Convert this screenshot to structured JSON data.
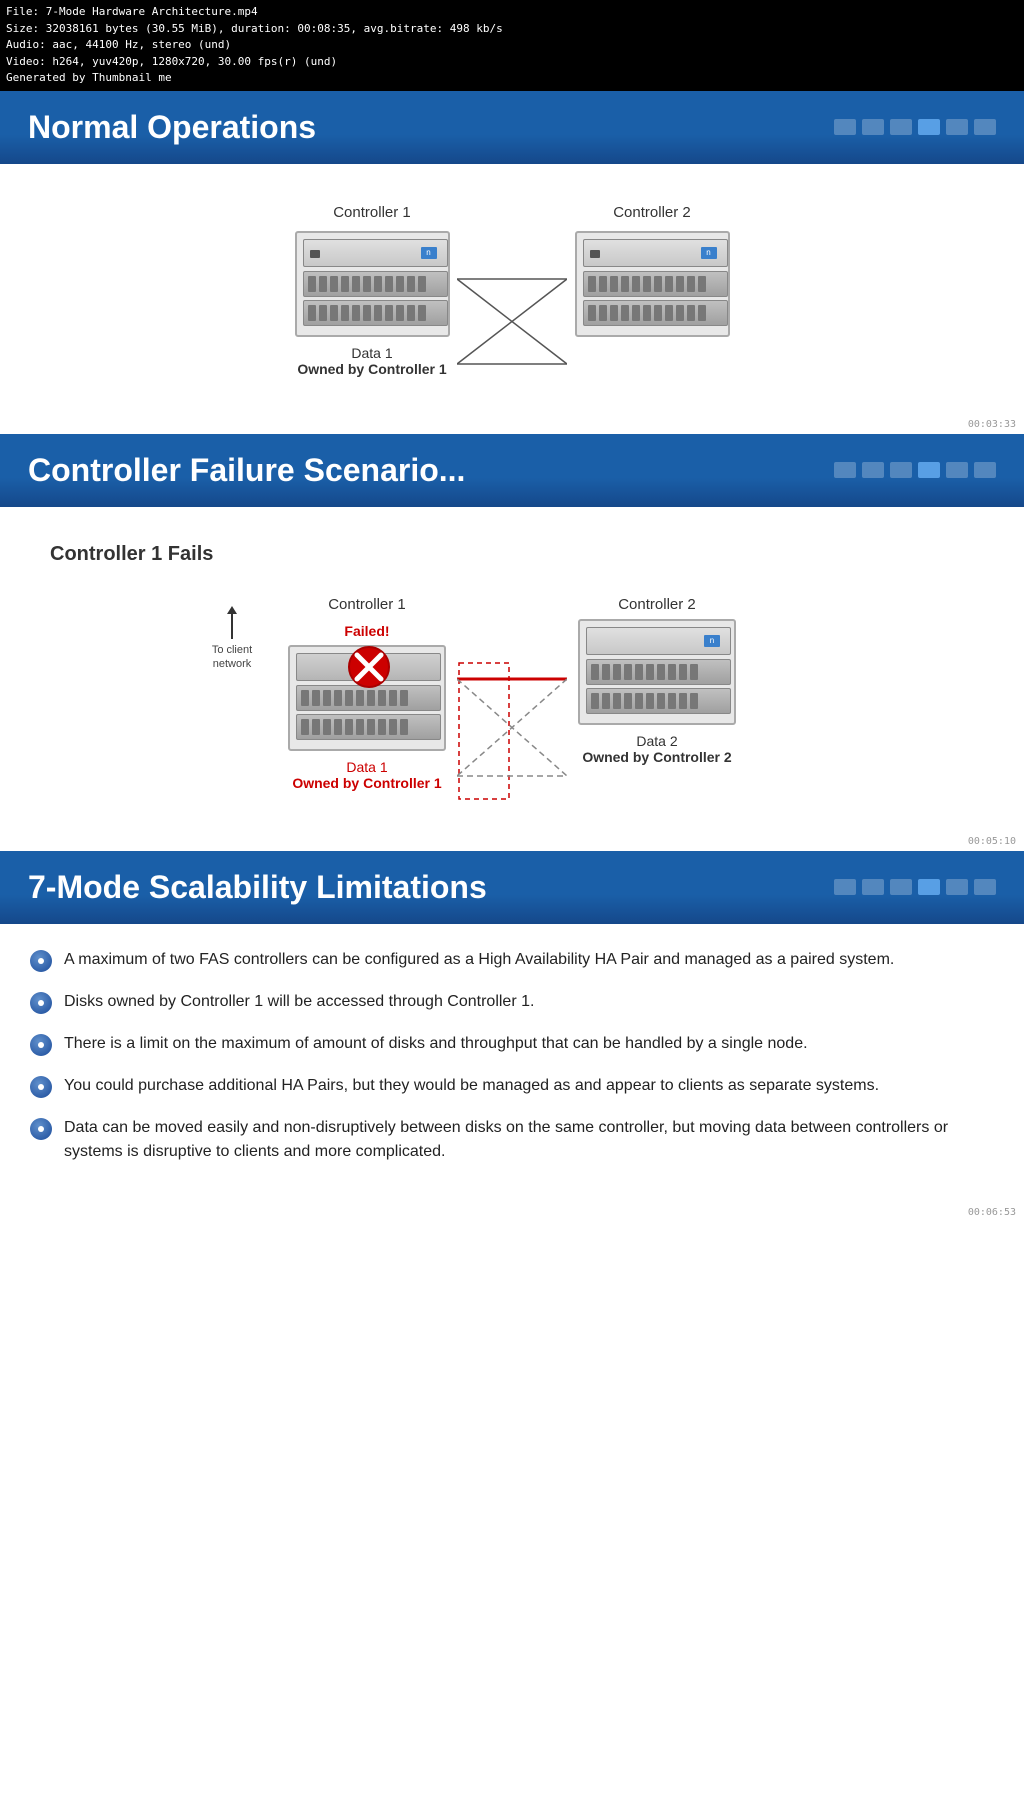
{
  "fileInfo": {
    "line1": "File: 7-Mode Hardware Architecture.mp4",
    "line2": "Size: 32038161 bytes (30.55 MiB), duration: 00:08:35, avg.bitrate: 498 kb/s",
    "line3": "Audio: aac, 44100 Hz, stereo (und)",
    "line4": "Video: h264, yuv420p, 1280x720, 30.00 fps(r) (und)",
    "line5": "Generated by Thumbnail me"
  },
  "slides": {
    "slide1": {
      "title": "Normal Operations",
      "controller1Label": "Controller 1",
      "controller2Label": "Controller 2",
      "data1Label": "Data 1",
      "data1Owner": "Owned by Controller 1",
      "timestamp": "00:03:33",
      "navDots": [
        false,
        false,
        false,
        true,
        false,
        false
      ]
    },
    "slide2": {
      "title": "Controller Failure Scenario...",
      "subtitle": "Controller 1 Fails",
      "controller1Label": "Controller 1",
      "controller1Status": "Failed!",
      "controller2Label": "Controller 2",
      "data1Label": "Data 1",
      "data1Owner": "Owned by Controller 1",
      "data2Label": "Data 2",
      "data2Owner": "Owned by Controller 2",
      "toClientLabel": "To client network",
      "timestamp": "00:05:10",
      "navDots": [
        false,
        false,
        false,
        true,
        false,
        false
      ]
    },
    "slide3": {
      "title": "7-Mode Scalability Limitations",
      "timestamp": "00:06:53",
      "navDots": [
        false,
        false,
        false,
        true,
        false,
        false
      ],
      "bullets": [
        "A maximum of two FAS controllers can be configured as a High Availability HA Pair and managed as a paired system.",
        "Disks owned by Controller 1 will be accessed through Controller 1.",
        "There is a limit on the maximum of amount of disks and throughput that can be handled by a single node.",
        "You could purchase additional HA Pairs, but they would be managed as and appear to clients as separate systems.",
        "Data can be moved easily and non-disruptively between disks on the same controller, but moving data between controllers or systems is disruptive to clients and more complicated."
      ]
    }
  }
}
